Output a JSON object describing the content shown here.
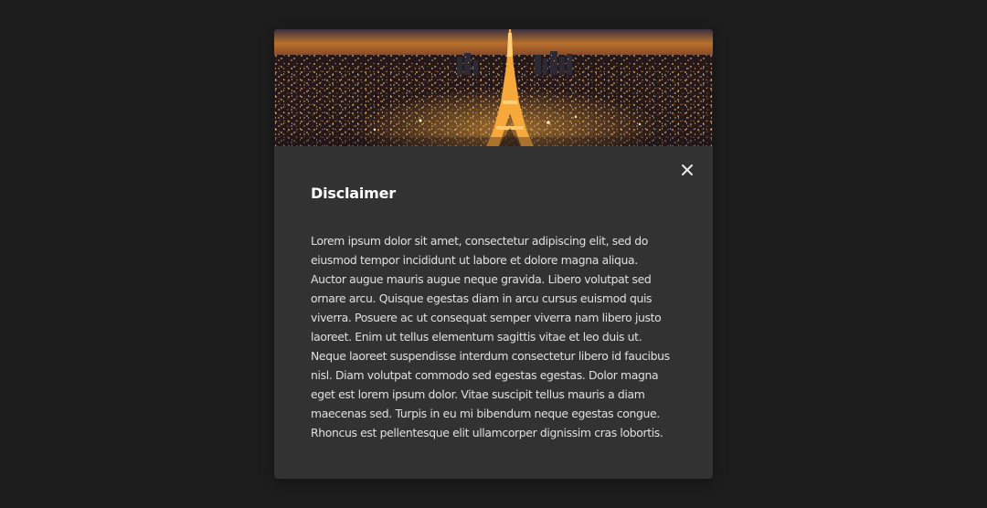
{
  "dialog": {
    "hero_image": "paris-eiffel-tower-night-skyline",
    "close_icon": "close-icon",
    "title": "Disclaimer",
    "body": "Lorem ipsum dolor sit amet, consectetur adipiscing elit, sed do eiusmod tempor incididunt ut labore et dolore magna aliqua. Auctor augue mauris augue neque gravida. Libero volutpat sed ornare arcu. Quisque egestas diam in arcu cursus euismod quis viverra. Posuere ac ut consequat semper viverra nam libero justo laoreet. Enim ut tellus elementum sagittis vitae et leo duis ut. Neque laoreet suspendisse interdum consectetur libero id faucibus nisl. Diam volutpat commodo sed egestas egestas. Dolor magna eget est lorem ipsum dolor. Vitae suscipit tellus mauris a diam maecenas sed. Turpis in eu mi bibendum neque egestas congue. Rhoncus est pellentesque elit ullamcorper dignissim cras lobortis."
  },
  "colors": {
    "backdrop": "#1d1d1d",
    "dialog_background": "#323232",
    "title_text": "#ffffff",
    "body_text": "#e0e0e0"
  }
}
